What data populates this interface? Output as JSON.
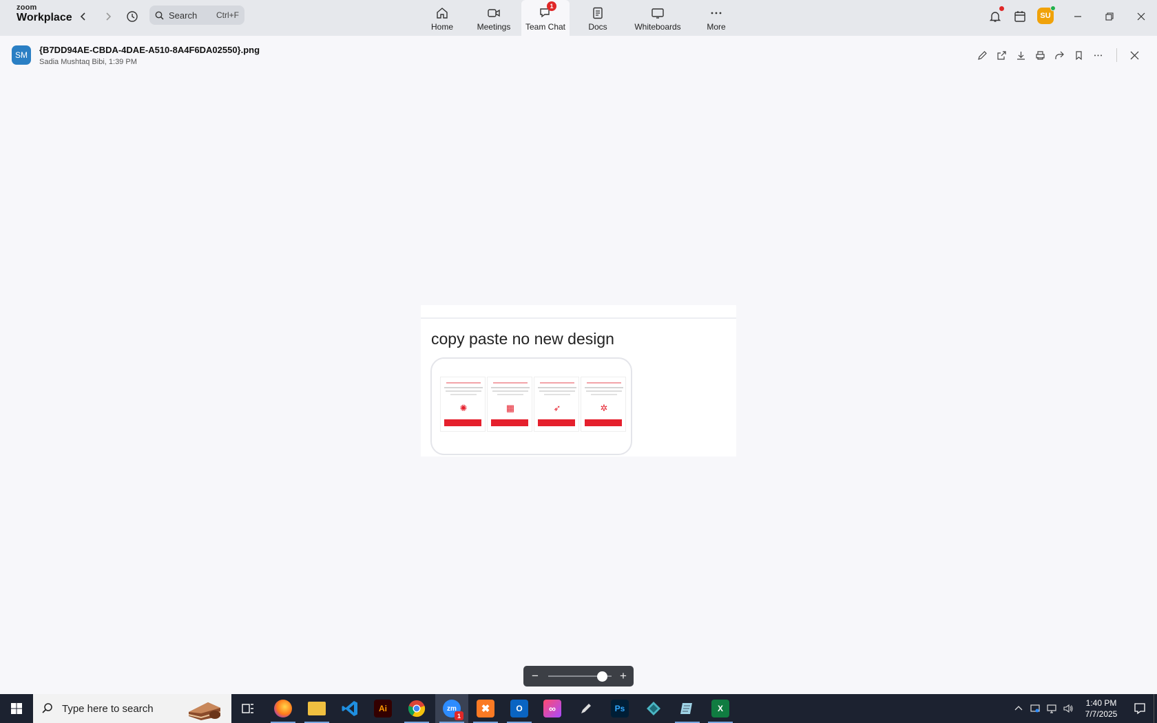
{
  "app": {
    "brand_small": "zoom",
    "brand_big": "Workplace"
  },
  "search": {
    "label": "Search",
    "shortcut": "Ctrl+F"
  },
  "tabs": [
    {
      "label": "Home",
      "icon": "home-icon"
    },
    {
      "label": "Meetings",
      "icon": "video-icon"
    },
    {
      "label": "Team Chat",
      "icon": "chat-icon",
      "badge": "1",
      "active": true
    },
    {
      "label": "Docs",
      "icon": "doc-icon"
    },
    {
      "label": "Whiteboards",
      "icon": "whiteboard-icon"
    },
    {
      "label": "More",
      "icon": "more-icon"
    }
  ],
  "user": {
    "initials": "SU",
    "status": "online"
  },
  "file": {
    "avatar_initials": "SM",
    "name": "{B7DD94AE-CBDA-4DAE-A510-8A4F6DA02550}.png",
    "meta": "Sadia Mushtaq Bibi, 1:39 PM"
  },
  "preview": {
    "caption": "copy paste no new design"
  },
  "zoom": {
    "level": 0.85,
    "minus": "−",
    "plus": "+"
  },
  "taskbar": {
    "search_placeholder": "Type here to search",
    "time": "1:40 PM",
    "date": "7/7/2025",
    "apps": [
      {
        "name": "task-view",
        "label": ""
      },
      {
        "name": "firefox",
        "label": ""
      },
      {
        "name": "file-explorer",
        "label": ""
      },
      {
        "name": "vscode",
        "label": ""
      },
      {
        "name": "illustrator",
        "label": "Ai"
      },
      {
        "name": "chrome",
        "label": ""
      },
      {
        "name": "zoom",
        "label": "zm",
        "badge": "1"
      },
      {
        "name": "xampp",
        "label": ""
      },
      {
        "name": "outlook",
        "label": ""
      },
      {
        "name": "creative-cloud",
        "label": ""
      },
      {
        "name": "pen-tool",
        "label": ""
      },
      {
        "name": "photoshop",
        "label": "Ps"
      },
      {
        "name": "app-diamond",
        "label": ""
      },
      {
        "name": "notepad",
        "label": ""
      },
      {
        "name": "excel",
        "label": ""
      }
    ]
  },
  "colors": {
    "accent_red": "#e5202d",
    "badge_red": "#e02828",
    "avatar_orange": "#f0a20a",
    "avatar_blue": "#2a7fc4",
    "taskbar": "#1c2230"
  }
}
